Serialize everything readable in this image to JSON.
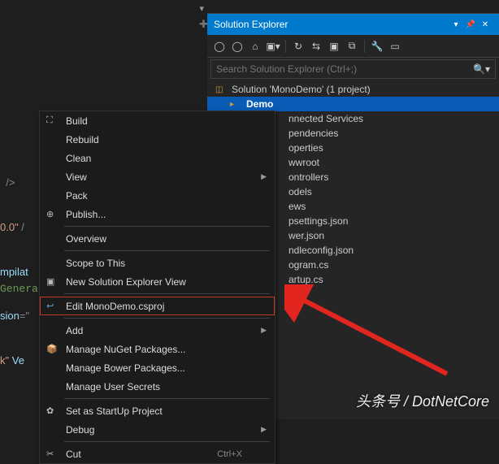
{
  "editor": {
    "code_line1": "  />",
    "code_line2_a": "0.0\"",
    "code_line2_b": " /",
    "code_line3": "mpilat",
    "code_line4_a": "sion",
    "code_line4_b": "=\"",
    "code_line5_a": "k\"",
    "code_line5_b": " Ve",
    "generate": "Genera"
  },
  "panel": {
    "title": "Solution Explorer",
    "search_placeholder": "Search Solution Explorer (Ctrl+;)",
    "solution": "Solution 'MonoDemo' (1 project)",
    "project": "Demo",
    "items": [
      "nnected Services",
      "pendencies",
      "operties",
      "wwroot",
      "ontrollers",
      "odels",
      "ews",
      "psettings.json",
      "wer.json",
      "ndleconfig.json",
      "ogram.cs",
      "artup.cs"
    ]
  },
  "menu": {
    "build": "Build",
    "rebuild": "Rebuild",
    "clean": "Clean",
    "view": "View",
    "pack": "Pack",
    "publish": "Publish...",
    "overview": "Overview",
    "scope": "Scope to This",
    "newview": "New Solution Explorer View",
    "edit": "Edit MonoDemo.csproj",
    "add": "Add",
    "nuget": "Manage NuGet Packages...",
    "bower": "Manage Bower Packages...",
    "secrets": "Manage User Secrets",
    "startup": "Set as StartUp Project",
    "debug": "Debug",
    "cut": "Cut",
    "cut_key": "Ctrl+X"
  },
  "watermark": "头条号 / DotNetCore"
}
